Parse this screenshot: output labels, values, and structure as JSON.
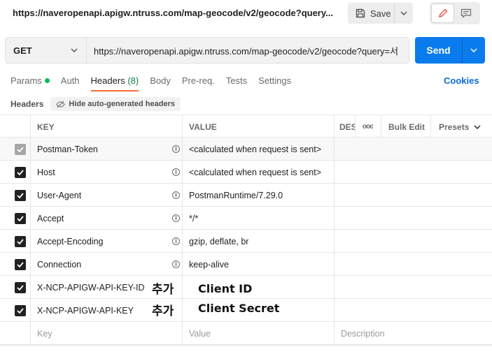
{
  "request": {
    "title": "https://naveropenapi.apigw.ntruss.com/map-geocode/v2/geocode?query...",
    "method": "GET",
    "url": "https://naveropenapi.apigw.ntruss.com/map-geocode/v2/geocode?query=서",
    "save_label": "Save",
    "send_label": "Send"
  },
  "tabs": [
    {
      "label": "Params",
      "indicator": "green-dot"
    },
    {
      "label": "Auth"
    },
    {
      "label": "Headers",
      "count": "(8)",
      "active": true
    },
    {
      "label": "Body"
    },
    {
      "label": "Pre-req."
    },
    {
      "label": "Tests"
    },
    {
      "label": "Settings"
    }
  ],
  "cookies_label": "Cookies",
  "headers_section": {
    "title": "Headers",
    "hide_auto_label": "Hide auto-generated headers"
  },
  "table": {
    "columns": {
      "key": "KEY",
      "value": "VALUE",
      "description": "DES"
    },
    "more_label": "ooo",
    "bulk_edit_label": "Bulk Edit",
    "presets_label": "Presets",
    "rows": [
      {
        "key": "Postman-Token",
        "value": "<calculated when request is sent>",
        "checked": true,
        "auto": true,
        "info": true
      },
      {
        "key": "Host",
        "value": "<calculated when request is sent>",
        "checked": true,
        "info": true
      },
      {
        "key": "User-Agent",
        "value": "PostmanRuntime/7.29.0",
        "checked": true,
        "info": true
      },
      {
        "key": "Accept",
        "value": "*/*",
        "checked": true,
        "info": true
      },
      {
        "key": "Accept-Encoding",
        "value": "gzip, deflate, br",
        "checked": true,
        "info": true
      },
      {
        "key": "Connection",
        "value": "keep-alive",
        "checked": true,
        "info": true
      },
      {
        "key": "X-NCP-APIGW-API-KEY-ID",
        "value": "",
        "checked": true,
        "annotation": "추가",
        "value_annotation": "Client ID"
      },
      {
        "key": "X-NCP-APIGW-API-KEY",
        "value": "",
        "checked": true,
        "annotation": "추가",
        "value_annotation": "Client Secret"
      }
    ],
    "new_row": {
      "key_placeholder": "Key",
      "value_placeholder": "Value",
      "description_placeholder": "Description"
    }
  },
  "colors": {
    "send": "#097bed",
    "active_tab_underline": "#ff6c37",
    "params_dot": "#0cbb52",
    "headers_count": "#0f7b46",
    "cookies": "#0b6ad5"
  }
}
